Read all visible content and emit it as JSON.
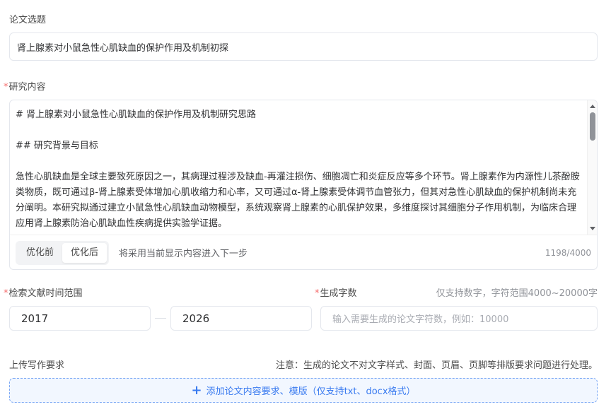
{
  "topic": {
    "label": "论文选题",
    "value": "肾上腺素对小鼠急性心肌缺血的保护作用及机制初探"
  },
  "research": {
    "required_mark": "*",
    "label": "研究内容",
    "lines": {
      "h1": "# 肾上腺素对小鼠急性心肌缺血的保护作用及机制研究思路",
      "h2": "## 研究背景与目标",
      "p1": "急性心肌缺血是全球主要致死原因之一，其病理过程涉及缺血-再灌注损伤、细胞凋亡和炎症反应等多个环节。肾上腺素作为内源性儿茶酚胺类物质，既可通过β-肾上腺素受体增加心肌收缩力和心率，又可通过α-肾上腺素受体调节血管张力，但其对急性心肌缺血的保护机制尚未充分阐明。本研究拟通过建立小鼠急性心肌缺血动物模型，系统观察肾上腺素的心肌保护效果，多维度探讨其细胞分子作用机制，为临床合理应用肾上腺素防治心肌缺血性疾病提供实验学证据。"
    },
    "tabs": [
      "优化前",
      "优化后"
    ],
    "active_tab": "优化后",
    "hint": "将采用当前显示内容进入下一步",
    "counter": "1198/4000"
  },
  "time_range": {
    "required_mark": "*",
    "label": "检索文献时间范围",
    "start": "2017",
    "end": "2026"
  },
  "word_count": {
    "required_mark": "*",
    "label": "生成字数",
    "hint": "仅支持数字，字符范围4000~20000字",
    "placeholder": "输入需要生成的论文字符数，例如：10000"
  },
  "upload": {
    "label": "上传写作要求",
    "note": "注意：生成的论文不对文字样式、封面、页眉、页脚等排版要求问题进行处理。",
    "button_label": "添加论文内容要求、模版（仅支持txt、docx格式）",
    "icon": "plus-icon"
  },
  "colors": {
    "accent": "#3a7bf0",
    "required": "#f56c6c"
  }
}
